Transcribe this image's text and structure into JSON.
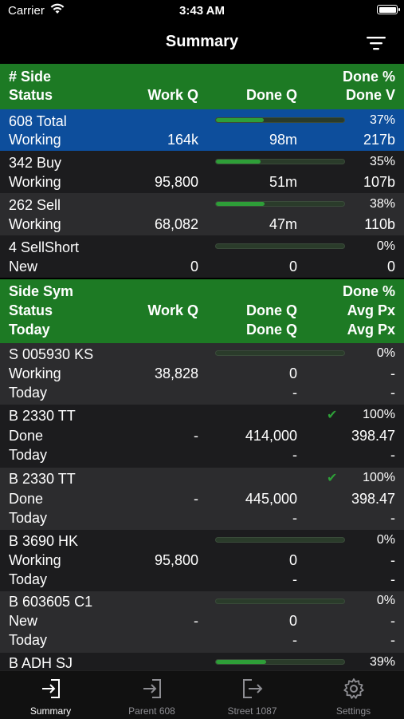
{
  "status_bar": {
    "carrier": "Carrier",
    "time": "3:43 AM"
  },
  "nav": {
    "title": "Summary"
  },
  "side_header": {
    "col1": [
      "# Side",
      "Status"
    ],
    "col2": [
      "",
      "Work Q"
    ],
    "col3": [
      "",
      "Done Q"
    ],
    "col4": [
      "Done %",
      "Done V"
    ]
  },
  "side_rows": [
    {
      "side": "608 Total",
      "status": "Working",
      "work_q": "164k",
      "done_q": "98m",
      "done_pct": "37%",
      "done_v": "217b",
      "progress": 0.37,
      "selected": true
    },
    {
      "side": "342 Buy",
      "status": "Working",
      "work_q": "95,800",
      "done_q": "51m",
      "done_pct": "35%",
      "done_v": "107b",
      "progress": 0.35
    },
    {
      "side": "262 Sell",
      "status": "Working",
      "work_q": "68,082",
      "done_q": "47m",
      "done_pct": "38%",
      "done_v": "110b",
      "progress": 0.38
    },
    {
      "side": "4 SellShort",
      "status": "New",
      "work_q": "0",
      "done_q": "0",
      "done_pct": "0%",
      "done_v": "0",
      "progress": 0
    }
  ],
  "order_header": {
    "col1": [
      "Side Sym",
      "Status",
      "Today"
    ],
    "col2": [
      "",
      "Work Q",
      ""
    ],
    "col3": [
      "",
      "Done Q",
      "Done Q"
    ],
    "col4": [
      "Done %",
      "Avg Px",
      "Avg Px"
    ]
  },
  "order_rows": [
    {
      "sym": "S 005930 KS",
      "status": "Working",
      "today": "Today",
      "work_q": "38,828",
      "done_q": "0",
      "today_done_q": "-",
      "done_pct": "0%",
      "avg_px": "-",
      "today_avg_px": "-",
      "progress": 0,
      "complete": false
    },
    {
      "sym": "B 2330 TT",
      "status": "Done",
      "today": "Today",
      "work_q": "-",
      "done_q": "414,000",
      "today_done_q": "-",
      "done_pct": "100%",
      "avg_px": "398.47",
      "today_avg_px": "-",
      "progress": 1,
      "complete": true
    },
    {
      "sym": "B 2330 TT",
      "status": "Done",
      "today": "Today",
      "work_q": "-",
      "done_q": "445,000",
      "today_done_q": "-",
      "done_pct": "100%",
      "avg_px": "398.47",
      "today_avg_px": "-",
      "progress": 1,
      "complete": true
    },
    {
      "sym": "B 3690 HK",
      "status": "Working",
      "today": "Today",
      "work_q": "95,800",
      "done_q": "0",
      "today_done_q": "-",
      "done_pct": "0%",
      "avg_px": "-",
      "today_avg_px": "-",
      "progress": 0,
      "complete": false
    },
    {
      "sym": "B 603605 C1",
      "status": "New",
      "today": "Today",
      "work_q": "-",
      "done_q": "0",
      "today_done_q": "-",
      "done_pct": "0%",
      "avg_px": "-",
      "today_avg_px": "-",
      "progress": 0,
      "complete": false
    },
    {
      "sym": "B ADH SJ",
      "status": "",
      "today": "",
      "work_q": "",
      "done_q": "",
      "today_done_q": "",
      "done_pct": "39%",
      "avg_px": "",
      "today_avg_px": "",
      "progress": 0.39,
      "complete": false
    }
  ],
  "tabs": [
    {
      "label": "Summary",
      "icon": "login-arrow-icon",
      "active": true
    },
    {
      "label": "Parent 608",
      "icon": "login-arrow-icon",
      "active": false
    },
    {
      "label": "Street 1087",
      "icon": "logout-arrow-icon",
      "active": false
    },
    {
      "label": "Settings",
      "icon": "gear-icon",
      "active": false
    }
  ],
  "colors": {
    "header_green": "#1d7a24",
    "selected_blue": "#0d4e9c",
    "progress_green": "#2e9e38"
  }
}
